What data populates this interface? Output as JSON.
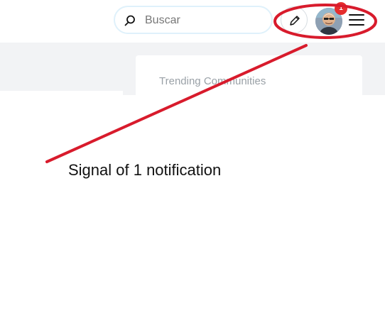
{
  "header": {
    "search": {
      "placeholder": "Buscar",
      "value": ""
    },
    "actions": {
      "pencil_icon": "pencil-icon",
      "avatar_icon": "avatar",
      "menu_icon": "hamburger-menu-icon",
      "notification_count": "1"
    }
  },
  "sidebar": {
    "trending_title": "Trending Communities"
  },
  "annotation": {
    "text": "Signal of 1 notification",
    "accent_color": "#d81b2c"
  },
  "colors": {
    "badge": "#e52d2d",
    "search_border": "#dff1fb",
    "background": "#f2f3f5"
  }
}
